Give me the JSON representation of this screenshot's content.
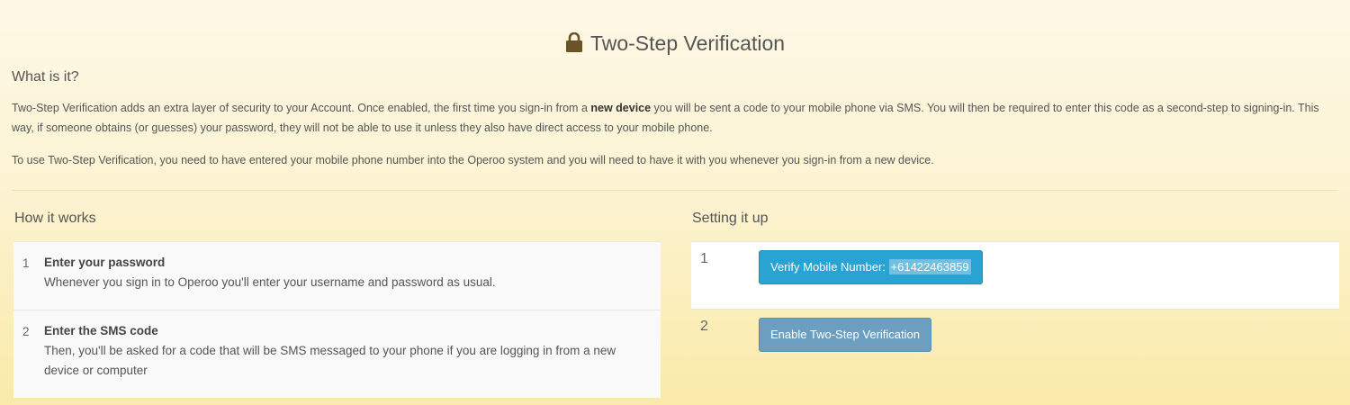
{
  "header": {
    "icon": "lock-icon",
    "title": "Two-Step Verification"
  },
  "what": {
    "heading": "What is it?",
    "p1_start": "Two-Step Verification adds an extra layer of security to your Account. Once enabled, the first time you sign-in from a ",
    "p1_bold": "new device",
    "p1_end": " you will be sent a code to your mobile phone via SMS. You will then be required to enter this code as a second-step to signing-in. This way, if someone obtains (or guesses) your password, they will not be able to use it unless they also have direct access to your mobile phone.",
    "p2": "To use Two-Step Verification, you need to have entered your mobile phone number into the Operoo system and you will need to have it with you whenever you sign-in from a new device."
  },
  "how": {
    "heading": "How it works",
    "items": [
      {
        "num": "1",
        "title": "Enter your password",
        "text": "Whenever you sign in to Operoo you'll enter your username and password as usual."
      },
      {
        "num": "2",
        "title": "Enter the SMS code",
        "text": "Then, you'll be asked for a code that will be SMS messaged to your phone if you are logging in from a new device or computer"
      }
    ]
  },
  "setup": {
    "heading": "Setting it up",
    "steps": [
      {
        "num": "1",
        "button_label": "Verify Mobile Number:",
        "phone": "+61422463859"
      },
      {
        "num": "2",
        "button_label": "Enable Two-Step Verification"
      }
    ]
  },
  "colors": {
    "verify_button": "#28a3d4",
    "enable_button": "#6c9fbf",
    "background_top": "#fdf8e6",
    "background_bottom": "#f9eaa8"
  }
}
